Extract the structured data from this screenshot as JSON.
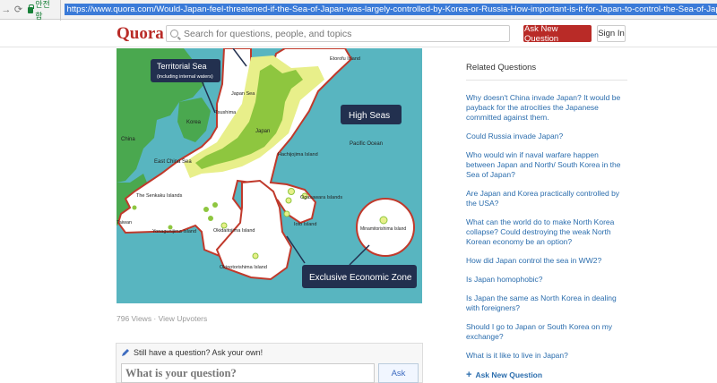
{
  "browser": {
    "back_icon": "arrow-right-icon",
    "reload_icon": "reload-icon",
    "secure_label": "안전함",
    "url": "https://www.quora.com/Would-Japan-feel-threatened-if-the-Sea-of-Japan-was-largely-controlled-by-Korea-or-Russia-How-important-is-it-for-Japan-to-control-the-Sea-of-Japan"
  },
  "header": {
    "logo": "Quora",
    "search_placeholder": "Search for questions, people, and topics",
    "ask_button": "Ask New Question",
    "signin_button": "Sign In"
  },
  "map": {
    "territorial_title": "Territorial Sea",
    "territorial_sub": "(including internal waters)",
    "high_seas": "High Seas",
    "eez": "Exclusive Economic Zone",
    "places": {
      "etorofu": "Etorofu Island",
      "japan_sea": "Japan Sea",
      "tsushima": "Tsushima",
      "korea": "Korea",
      "japan": "Japan",
      "china": "China",
      "pacific": "Pacific Ocean",
      "east_china_sea": "East China Sea",
      "hachijojima": "Hachijojima Island",
      "ogasawara": "Ogasawara Islands",
      "senkaku": "The Senkaku Islands",
      "taiwan": "Taiwan",
      "yonaguni": "Yonagunijima Island",
      "okidaito": "Okidaitojima Island",
      "ioto": "Ioto Island",
      "minamitori": "Minamitorishima Island",
      "okinotori": "Okinotorishima Island"
    }
  },
  "views": "796 Views · View Upvoters",
  "askbox": {
    "heading": "Still have a question? Ask your own!",
    "input_placeholder": "What is your question?",
    "button": "Ask"
  },
  "related": {
    "title": "Related Questions",
    "questions": [
      "Why doesn't China invade Japan? It would be payback for the atrocities the Japanese committed against them.",
      "Could Russia invade Japan?",
      "Who would win if naval warfare happen between Japan and North/ South Korea in the Sea of Japan?",
      "Are Japan and Korea practically controlled by the USA?",
      "What can the world do to make North Korea collapse? Could destroying the weak North Korean economy be an option?",
      "How did Japan control the sea in WW2?",
      "Is Japan homophobic?",
      "Is Japan the same as North Korea in dealing with foreigners?",
      "Should I go to Japan or South Korea on my exchange?",
      "What is it like to live in Japan?"
    ],
    "add_question": "Ask New Question"
  },
  "colors": {
    "brand_red": "#b92b27",
    "link_blue": "#2b6dad",
    "sea": "#58b5c0",
    "eez_fill": "#ffffff",
    "eez_border": "#c0392b",
    "territorial": "#e8ef8a",
    "land_japan": "#8ec63f",
    "land_other": "#4aa84f",
    "label_navy": "#22304f"
  }
}
